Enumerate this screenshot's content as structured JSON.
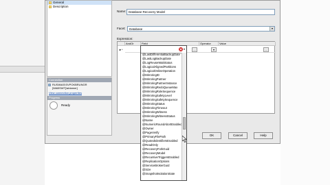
{
  "window": {
    "nav_items": [
      {
        "label": "General",
        "selected": true
      },
      {
        "label": "Description",
        "selected": false
      }
    ],
    "connection": {
      "header": "Connection",
      "server_name": "RUSIMAS\\SVPOKBRUNGR",
      "user_name": "[WABSWT]\\ablamer]",
      "link": "View connection properties"
    },
    "progress": {
      "header": "Progress",
      "status": "Ready"
    }
  },
  "form": {
    "name_label": "Name:",
    "name_value": "Database Recovery Model",
    "facet_label": "Facet:",
    "facet_value": "Database",
    "expression_label": "Expression:",
    "grid": {
      "columns": [
        "AndOr",
        "Field",
        "Operator",
        "Value"
      ],
      "row_marker": "►*"
    },
    "buttons": {
      "ok": "OK",
      "cancel": "Cancel",
      "help": "Help"
    }
  },
  "dropdown": {
    "items": [
      "@LastDifferentialBackupDate",
      "@LastLogBackupDate",
      "@LogReuseWaitStatus",
      "@LogicalAlignedPartitions",
      "@LogicalOnlineOperation",
      "@MirroringID",
      "@MirroringPartner",
      "@MirroringPartnerInstance",
      "@MirroringRedoQueueMax",
      "@MirroringRoleSequence",
      "@MirroringSafetyLevel",
      "@MirroringSafetySequence",
      "@MirroringStatus",
      "@MirroringTimeout",
      "@MirroringWitness",
      "@MirroringWitnessStatus",
      "@Name",
      "@NumericRoundAbortEnabled",
      "@Owner",
      "@PageVerify",
      "@PrimaryFilePath",
      "@QuotedIdentifiersEnabled",
      "@ReadOnly",
      "@RecoveryForkGuid",
      "@RecoveryModel",
      "@RecursiveTriggersEnabled",
      "@ReplicationOptions",
      "@ServiceBrokerGuid",
      "@Size",
      "@SnapshotIsolationState"
    ],
    "scroll_fraction": 0.55
  }
}
